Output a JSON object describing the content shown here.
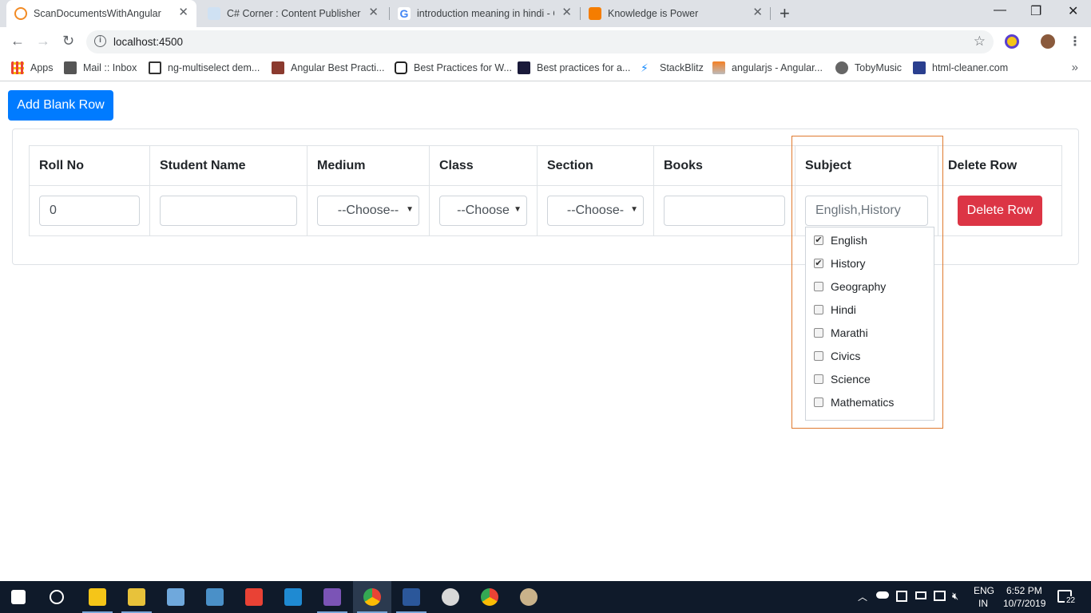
{
  "browser": {
    "tabs": [
      {
        "title": "ScanDocumentsWithAngular",
        "active": true,
        "favicon_color": "#f28b25"
      },
      {
        "title": "C# Corner : Content Publisher",
        "active": false,
        "favicon_color": "#6aa3d6"
      },
      {
        "title": "introduction meaning in hindi - G",
        "active": false,
        "favicon_color": "#4285f4"
      },
      {
        "title": "Knowledge is Power",
        "active": false,
        "favicon_color": "#f57d00"
      }
    ],
    "url": "localhost:4500",
    "bookmarks": [
      {
        "label": "Apps",
        "icon": "apps-grid-icon"
      },
      {
        "label": "Mail :: Inbox",
        "icon": "mail-icon"
      },
      {
        "label": "ng-multiselect dem...",
        "icon": "download-icon"
      },
      {
        "label": "Angular Best Practi...",
        "icon": "bookmark-icon"
      },
      {
        "label": "Best Practices for W...",
        "icon": "page-icon"
      },
      {
        "label": "Best practices for a...",
        "icon": "angular-icon"
      },
      {
        "label": "StackBlitz",
        "icon": "stackblitz-icon"
      },
      {
        "label": "angularjs - Angular...",
        "icon": "stackoverflow-icon"
      },
      {
        "label": "TobyMusic",
        "icon": "globe-icon"
      },
      {
        "label": "html-cleaner.com",
        "icon": "cleaner-icon"
      }
    ]
  },
  "page": {
    "add_button": "Add Blank Row",
    "columns": [
      "Roll No",
      "Student Name",
      "Medium",
      "Class",
      "Section",
      "Books",
      "Subject",
      "Delete Row"
    ],
    "row": {
      "roll_no": "0",
      "student_name": "",
      "medium": "--Choose--",
      "class": "--Choose",
      "section": "--Choose-",
      "books": "",
      "subject_placeholder": "English,History",
      "delete_button": "Delete Row"
    },
    "subject_options": [
      {
        "label": "English",
        "checked": true
      },
      {
        "label": "History",
        "checked": true
      },
      {
        "label": "Geography",
        "checked": false
      },
      {
        "label": "Hindi",
        "checked": false
      },
      {
        "label": "Marathi",
        "checked": false
      },
      {
        "label": "Civics",
        "checked": false
      },
      {
        "label": "Science",
        "checked": false
      },
      {
        "label": "Mathematics",
        "checked": false
      }
    ]
  },
  "taskbar": {
    "language": "ENG",
    "region": "IN",
    "time": "6:52 PM",
    "date": "10/7/2019",
    "notifications": "22"
  }
}
